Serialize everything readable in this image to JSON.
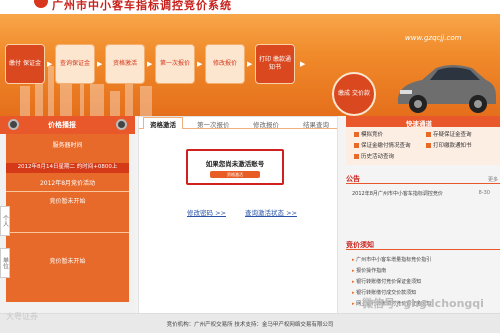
{
  "header": {
    "site_title": "广州市中小客车指标调控竞价系统",
    "url": "www.gzqcjj.com"
  },
  "steps": [
    "缴付\n保证金",
    "查询保证金",
    "资格激活",
    "第一次报价",
    "修改报价",
    "打印\n缴款通知书",
    "缴成\n交价款"
  ],
  "left_panel": {
    "title": "价格播报",
    "server_time_label": "服务器时间",
    "server_time": "2012年8月14日星期二 的时间+0800上",
    "month_activity": "2012年8月竞价活动",
    "status1": "竞价暂未开始",
    "status2": "竞价暂未开始",
    "side_tab1": "个人",
    "side_tab2": "单位"
  },
  "center": {
    "tabs": [
      "资格激活",
      "第一次报价",
      "修改报价",
      "结果查询"
    ],
    "query_label": "如果您尚未激活账号",
    "query_button": "资格激活",
    "link1": "修改密码 >>",
    "link2": "查询激活状态 >>"
  },
  "right_panel": {
    "quick_title": "快速通道",
    "quick_items": [
      "模拟竞价",
      "存疑保证金查询",
      "保证金缴付情况查询",
      "打印缴款通知书",
      "历史活动查询"
    ],
    "announce_title": "公告",
    "announce_more": "更多",
    "announce_items": [
      {
        "text": "2012年8月广州市中小客车指标调控竞价",
        "date": "8-30"
      }
    ],
    "guide_title": "竞价须知",
    "guide_items": [
      "广州市中小客车增量指标竞价指引",
      "报价操作指南",
      "银行转账缴付竞价保证金须知",
      "银行转账缴付成交价款须知",
      "网上银行转账缴付竞价保证金须知"
    ]
  },
  "footer": {
    "text": "竞价机构：广州产权交易所 技术支持：金马甲产权网络交易有限公司"
  },
  "watermarks": {
    "left": "大粤证券",
    "right": "微信号: ghgdchongqi"
  },
  "colors": {
    "brand": "#c8201a",
    "accent": "#e9582a",
    "banner": "#f08a2a"
  }
}
